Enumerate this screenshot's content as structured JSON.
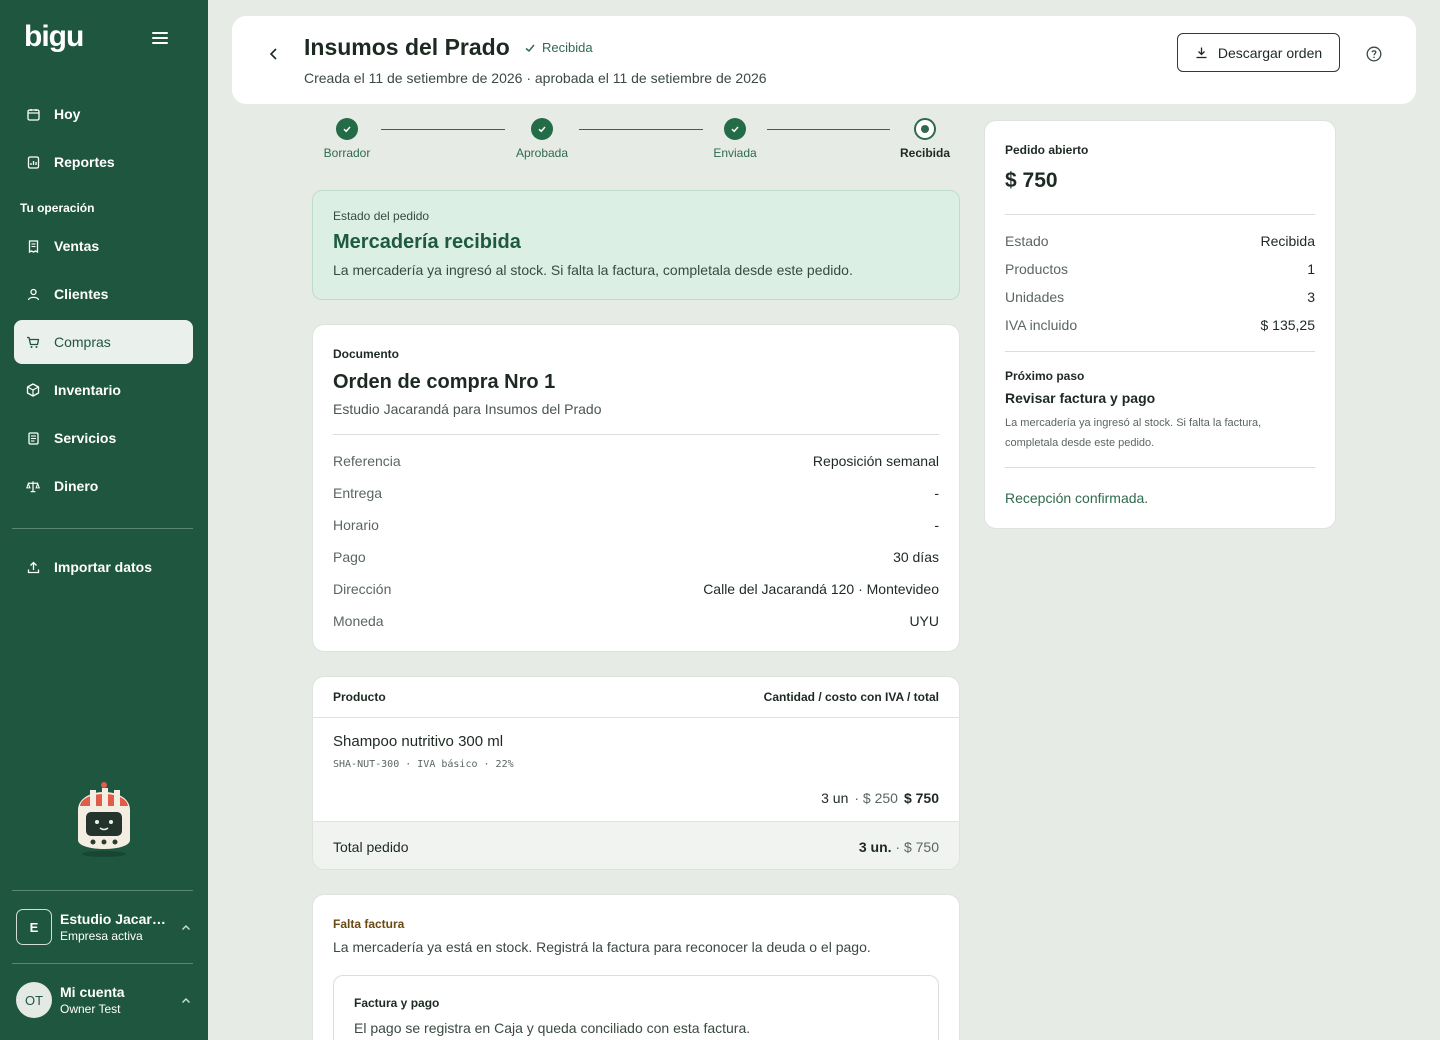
{
  "sidebar": {
    "logo": "bigu",
    "nav_top": [
      {
        "label": "Hoy",
        "icon": "calendar-icon"
      },
      {
        "label": "Reportes",
        "icon": "report-icon"
      }
    ],
    "section_label": "Tu operación",
    "nav_ops": [
      {
        "label": "Ventas",
        "icon": "receipt-icon"
      },
      {
        "label": "Clientes",
        "icon": "user-icon"
      },
      {
        "label": "Compras",
        "icon": "cart-icon",
        "active": true
      },
      {
        "label": "Inventario",
        "icon": "box-icon"
      },
      {
        "label": "Servicios",
        "icon": "document-icon"
      },
      {
        "label": "Dinero",
        "icon": "scale-icon"
      }
    ],
    "import_label": "Importar datos",
    "company": {
      "initial": "E",
      "name": "Estudio Jacarandá",
      "sub": "Empresa activa"
    },
    "account": {
      "initials": "OT",
      "name": "Mi cuenta",
      "sub": "Owner Test"
    }
  },
  "header": {
    "title": "Insumos del Prado",
    "status": "Recibida",
    "subtitle": "Creada el 11 de setiembre de 2026 · aprobada el 11 de setiembre de 2026",
    "download_label": "Descargar orden"
  },
  "stepper": {
    "steps": [
      {
        "label": "Borrador",
        "state": "done"
      },
      {
        "label": "Aprobada",
        "state": "done"
      },
      {
        "label": "Enviada",
        "state": "done"
      },
      {
        "label": "Recibida",
        "state": "current"
      }
    ]
  },
  "status_banner": {
    "label": "Estado del pedido",
    "title": "Mercadería recibida",
    "description": "La mercadería ya ingresó al stock. Si falta la factura, completala desde este pedido."
  },
  "document": {
    "label": "Documento",
    "title": "Orden de compra Nro 1",
    "subtitle": "Estudio Jacarandá para Insumos del Prado",
    "fields": [
      {
        "key": "Referencia",
        "value": "Reposición semanal"
      },
      {
        "key": "Entrega",
        "value": "-"
      },
      {
        "key": "Horario",
        "value": "-"
      },
      {
        "key": "Pago",
        "value": "30 días"
      },
      {
        "key": "Dirección",
        "value": "Calle del Jacarandá 120 · Montevideo"
      },
      {
        "key": "Moneda",
        "value": "UYU"
      }
    ]
  },
  "products": {
    "header_left": "Producto",
    "header_right": "Cantidad / costo con IVA / total",
    "items": [
      {
        "name": "Shampoo nutritivo 300 ml",
        "meta": "SHA-NUT-300 · IVA básico · 22%",
        "qty": "3 un",
        "cost": "· $ 250",
        "total": "$ 750"
      }
    ],
    "total_label": "Total pedido",
    "total_qty": "3 un.",
    "total_amount": "· $ 750"
  },
  "invoice": {
    "label": "Falta factura",
    "description": "La mercadería ya está en stock. Registrá la factura para reconocer la deuda o el pago.",
    "inner_label": "Factura y pago",
    "inner_description": "El pago se registra en Caja y queda conciliado con esta factura."
  },
  "summary": {
    "label": "Pedido abierto",
    "amount": "$ 750",
    "rows": [
      {
        "key": "Estado",
        "value": "Recibida"
      },
      {
        "key": "Productos",
        "value": "1"
      },
      {
        "key": "Unidades",
        "value": "3"
      },
      {
        "key": "IVA incluido",
        "value": "$ 135,25"
      }
    ],
    "next_label": "Próximo paso",
    "next_title": "Revisar factura y pago",
    "next_description": "La mercadería ya ingresó al stock. Si falta la factura, completala desde este pedido.",
    "link": "Recepción confirmada."
  },
  "colors": {
    "sidebar": "#1f5640",
    "accent": "#2f6a4f",
    "banner_bg": "#dcefe4",
    "page_bg": "#e7ebe6"
  }
}
